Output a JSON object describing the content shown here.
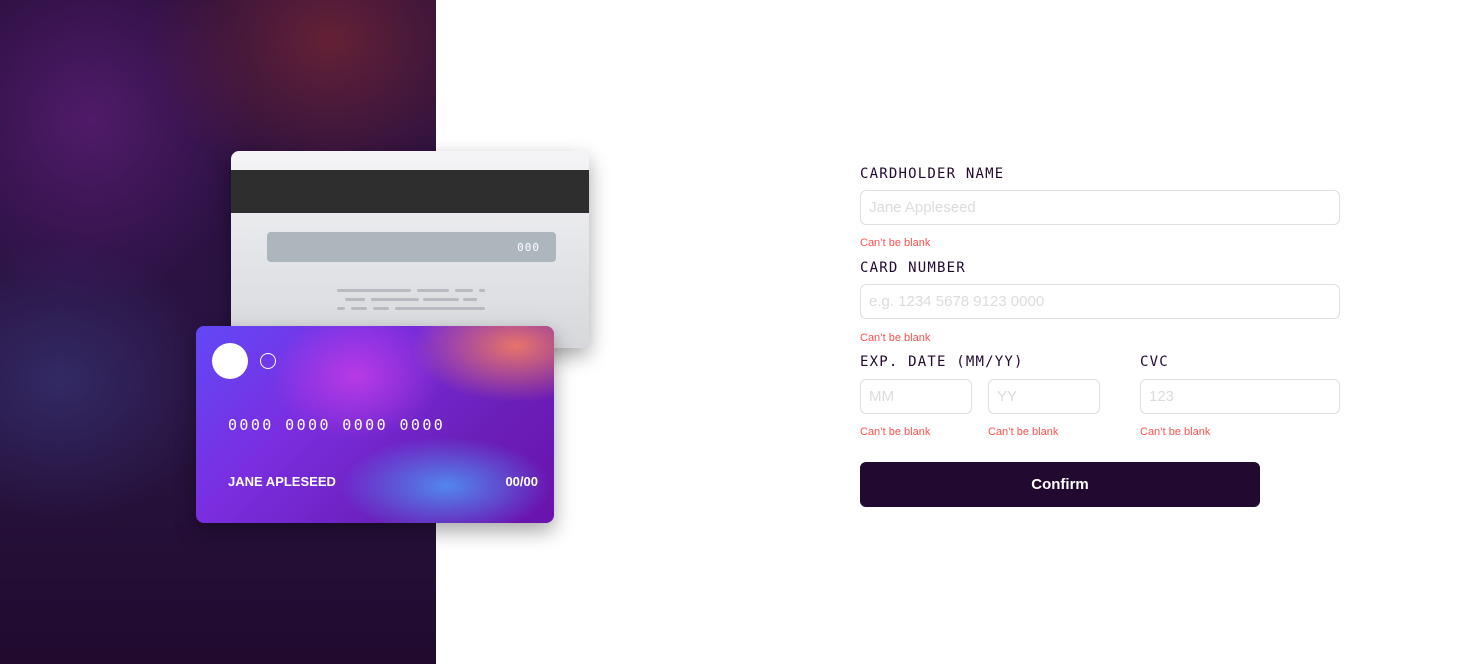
{
  "card_back": {
    "cvc": "000"
  },
  "card_front": {
    "number": "0000 0000 0000 0000",
    "holder": "JANE APLESEED",
    "expiry": "00/00"
  },
  "form": {
    "cardholder_name": {
      "label": "CARDHOLDER NAME",
      "placeholder": "Jane Appleseed",
      "value": "",
      "error": "Can’t be blank"
    },
    "card_number": {
      "label": "CARD NUMBER",
      "placeholder": "e.g. 1234 5678 9123 0000",
      "value": "",
      "error": "Can’t be blank"
    },
    "exp_date": {
      "label": "EXP. DATE (MM/YY)",
      "month_placeholder": "MM",
      "year_placeholder": "YY",
      "month_error": "Can’t be blank",
      "year_error": "Can’t be blank"
    },
    "cvc": {
      "label": "CVC",
      "placeholder": "123",
      "error": "Can’t be blank"
    },
    "confirm_label": "Confirm"
  },
  "colors": {
    "primary_dark": "#21092f",
    "error_red": "#ff5050",
    "input_border": "#dfdee0"
  }
}
